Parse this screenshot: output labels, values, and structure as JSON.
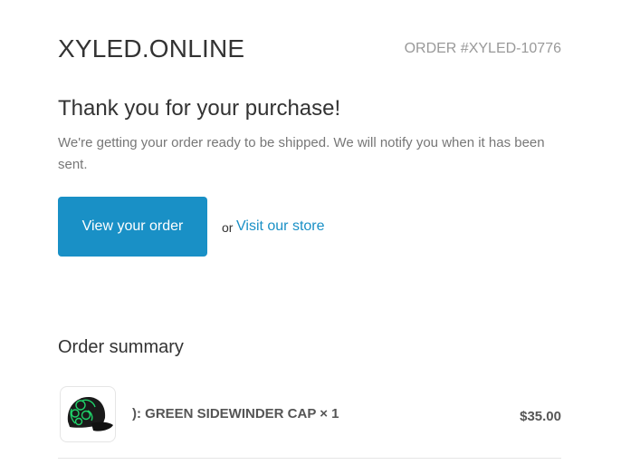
{
  "header": {
    "shop_name": "XYLED.ONLINE",
    "order_number": "ORDER #XYLED-10776"
  },
  "main": {
    "heading": "Thank you for your purchase!",
    "message": "We're getting your order ready to be shipped. We will notify you when it has been sent.",
    "view_order_label": "View your order",
    "or_text": "or",
    "visit_store_label": "Visit our store"
  },
  "summary": {
    "title": "Order summary",
    "items": [
      {
        "title": "): GREEN SIDEWINDER CAP × 1",
        "price": "$35.00",
        "image_icon": "green-sidewinder-cap-image"
      }
    ]
  },
  "colors": {
    "accent": "#1990c6",
    "muted_text": "#999999",
    "body_text": "#777777",
    "divider": "#e5e5e5"
  }
}
